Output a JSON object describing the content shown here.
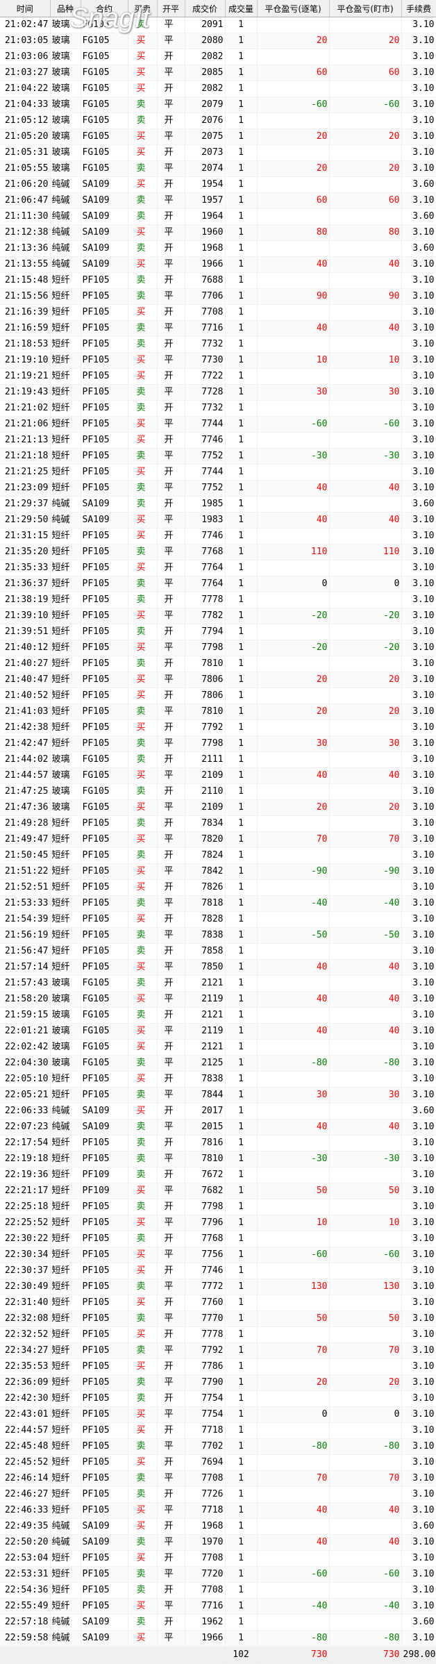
{
  "columns": [
    "时间",
    "品种",
    "合约",
    "买卖",
    "开平",
    "成交价",
    "成交量",
    "平仓盈亏(逐笔)",
    "平仓盈亏(盯市)",
    "手续费"
  ],
  "watermark": "SnagIt"
}
